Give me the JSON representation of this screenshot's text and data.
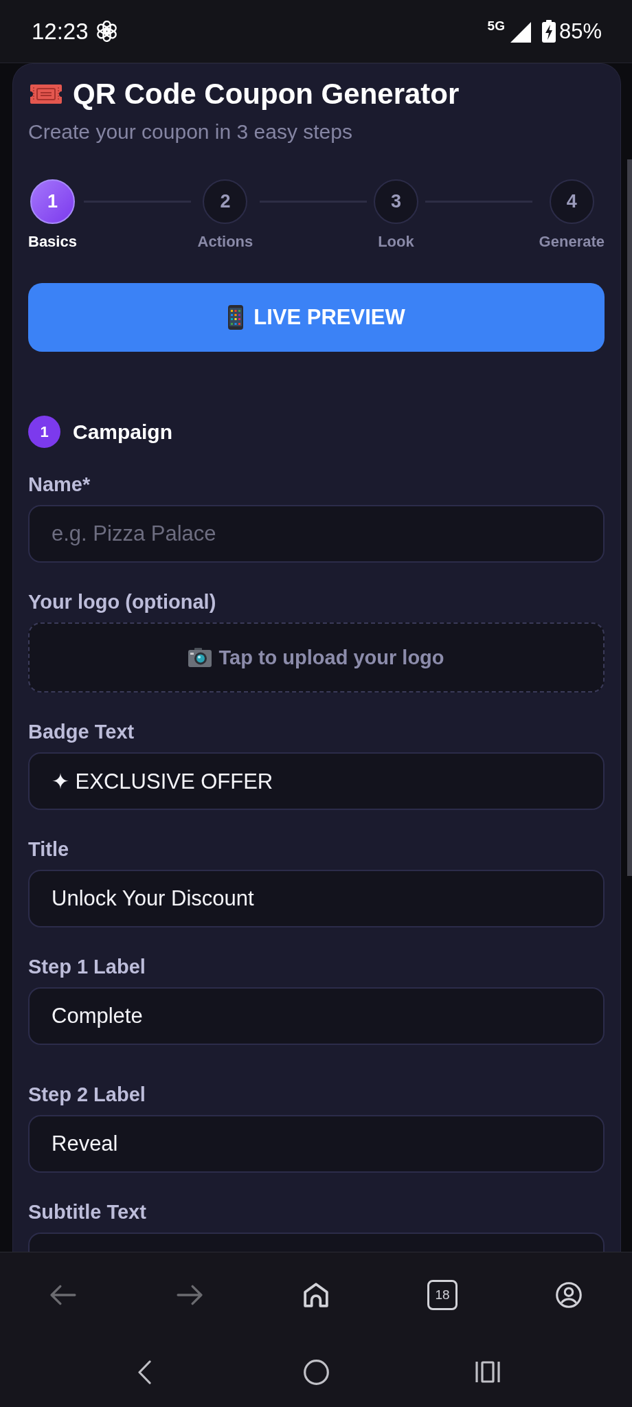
{
  "status_bar": {
    "time": "12:23",
    "network": "5G",
    "battery": "85%"
  },
  "header": {
    "title": "QR Code Coupon Generator",
    "subtitle": "Create your coupon in 3 easy steps"
  },
  "steps": [
    {
      "number": "1",
      "label": "Basics",
      "selected": true
    },
    {
      "number": "2",
      "label": "Actions",
      "selected": false
    },
    {
      "number": "3",
      "label": "Look",
      "selected": false
    },
    {
      "number": "4",
      "label": "Generate",
      "selected": false
    }
  ],
  "preview_button": {
    "label": "LIVE PREVIEW"
  },
  "section": {
    "number": "1",
    "title": "Campaign",
    "fields": [
      {
        "kind": "text",
        "label": "Name*",
        "placeholder": "e.g. Pizza Palace"
      },
      {
        "kind": "upload",
        "label": "Your logo (optional)",
        "prompt": "Tap to upload your logo"
      },
      {
        "kind": "text",
        "label": "Badge Text",
        "value": "✦ EXCLUSIVE OFFER"
      },
      {
        "kind": "text",
        "label": "Title",
        "value": "Unlock Your Discount"
      },
      {
        "kind": "text",
        "label": "Step 1 Label",
        "value": "Complete"
      },
      {
        "kind": "text",
        "label": "Step 2 Label",
        "value": "Reveal"
      },
      {
        "kind": "text",
        "label": "Subtitle Text"
      }
    ]
  },
  "browser_toolbar": {
    "buttons": [
      {
        "kind": "back",
        "disabled": true
      },
      {
        "kind": "forward",
        "disabled": true
      },
      {
        "kind": "home",
        "disabled": false
      },
      {
        "kind": "tabs",
        "label": "18",
        "disabled": false
      },
      {
        "kind": "account",
        "disabled": false
      }
    ]
  }
}
